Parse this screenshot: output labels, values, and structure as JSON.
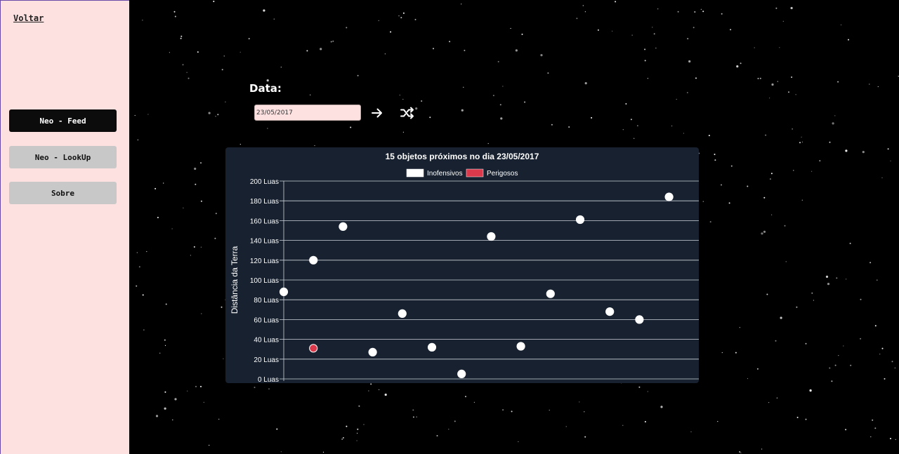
{
  "sidebar": {
    "back_label": "Voltar",
    "nav": [
      {
        "label": "Neo - Feed",
        "active": true
      },
      {
        "label": "Neo - LookUp",
        "active": false
      },
      {
        "label": "Sobre",
        "active": false
      }
    ]
  },
  "form": {
    "date_label": "Data:",
    "date_value": "23/05/2017",
    "submit_icon": "arrow-right-icon",
    "random_icon": "shuffle-icon"
  },
  "colors": {
    "sidebar_bg": "#fde0e0",
    "chart_bg": "#17212f",
    "harmless": "#ffffff",
    "dangerous": "#d9394a"
  },
  "chart_data": {
    "type": "scatter",
    "title": "15 objetos próximos no dia 23/05/2017",
    "ylabel": "Distância da Terra",
    "xlabel": "",
    "ylim": [
      0,
      200
    ],
    "yticks": [
      "0 Luas",
      "20 Luas",
      "40 Luas",
      "60 Luas",
      "80 Luas",
      "100 Luas",
      "120 Luas",
      "140 Luas",
      "160 Luas",
      "180 Luas",
      "200 Luas"
    ],
    "legend": [
      {
        "name": "Inofensivos",
        "color": "#ffffff"
      },
      {
        "name": "Perigosos",
        "color": "#d9394a"
      }
    ],
    "legend_position": "top",
    "grid": true,
    "points": [
      {
        "x": 0,
        "y": 88,
        "dangerous": false
      },
      {
        "x": 1,
        "y": 120,
        "dangerous": false
      },
      {
        "x": 1,
        "y": 31,
        "dangerous": true
      },
      {
        "x": 2,
        "y": 154,
        "dangerous": false
      },
      {
        "x": 3,
        "y": 27,
        "dangerous": false
      },
      {
        "x": 4,
        "y": 66,
        "dangerous": false
      },
      {
        "x": 5,
        "y": 32,
        "dangerous": false
      },
      {
        "x": 6,
        "y": 5,
        "dangerous": false
      },
      {
        "x": 7,
        "y": 144,
        "dangerous": false
      },
      {
        "x": 8,
        "y": 33,
        "dangerous": false
      },
      {
        "x": 9,
        "y": 86,
        "dangerous": false
      },
      {
        "x": 10,
        "y": 161,
        "dangerous": false
      },
      {
        "x": 11,
        "y": 68,
        "dangerous": false
      },
      {
        "x": 12,
        "y": 60,
        "dangerous": false
      },
      {
        "x": 13,
        "y": 184,
        "dangerous": false
      }
    ]
  }
}
